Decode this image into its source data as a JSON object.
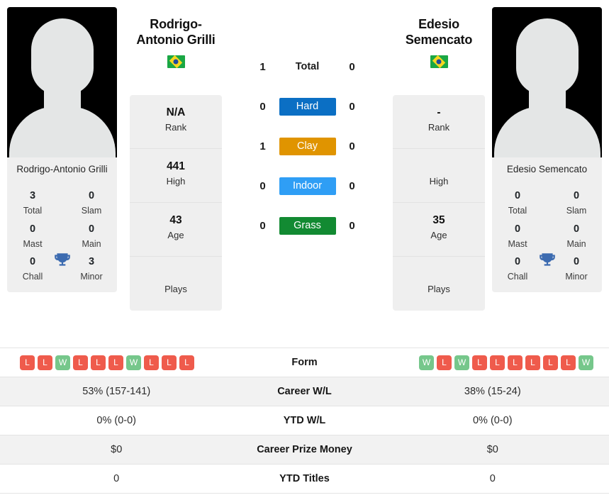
{
  "players": {
    "left": {
      "name": "Rodrigo-Antonio Grilli",
      "caption": "Rodrigo-Antonio Grilli",
      "country_flag": "brazil-flag",
      "info": [
        {
          "value": "N/A",
          "label": "Rank"
        },
        {
          "value": "441",
          "label": "High"
        },
        {
          "value": "43",
          "label": "Age"
        },
        {
          "value": "",
          "label": "Plays"
        }
      ],
      "titles": [
        {
          "value": "3",
          "label": "Total"
        },
        {
          "value": "0",
          "label": "Slam"
        },
        {
          "value": "0",
          "label": "Mast"
        },
        {
          "value": "0",
          "label": "Main"
        },
        {
          "value": "0",
          "label": "Chall"
        },
        {
          "value": "3",
          "label": "Minor"
        }
      ],
      "form": [
        "L",
        "L",
        "W",
        "L",
        "L",
        "L",
        "W",
        "L",
        "L",
        "L"
      ]
    },
    "right": {
      "name": "Edesio Semencato",
      "caption": "Edesio Semencato",
      "country_flag": "brazil-flag",
      "info": [
        {
          "value": "-",
          "label": "Rank"
        },
        {
          "value": "",
          "label": "High"
        },
        {
          "value": "35",
          "label": "Age"
        },
        {
          "value": "",
          "label": "Plays"
        }
      ],
      "titles": [
        {
          "value": "0",
          "label": "Total"
        },
        {
          "value": "0",
          "label": "Slam"
        },
        {
          "value": "0",
          "label": "Mast"
        },
        {
          "value": "0",
          "label": "Main"
        },
        {
          "value": "0",
          "label": "Chall"
        },
        {
          "value": "0",
          "label": "Minor"
        }
      ],
      "form": [
        "W",
        "L",
        "W",
        "L",
        "L",
        "L",
        "L",
        "L",
        "L",
        "W"
      ]
    }
  },
  "h2h": {
    "rows": [
      {
        "left": "1",
        "label": "Total",
        "right": "0",
        "type": "total",
        "color": ""
      },
      {
        "left": "0",
        "label": "Hard",
        "right": "0",
        "type": "surface",
        "color": "#0b6fc4"
      },
      {
        "left": "1",
        "label": "Clay",
        "right": "0",
        "type": "surface",
        "color": "#e09400"
      },
      {
        "left": "0",
        "label": "Indoor",
        "right": "0",
        "type": "surface",
        "color": "#2f9ef5"
      },
      {
        "left": "0",
        "label": "Grass",
        "right": "0",
        "type": "surface",
        "color": "#128a32"
      }
    ]
  },
  "comparison": {
    "rows": [
      {
        "label": "Form",
        "left": "",
        "right": "",
        "type": "form"
      },
      {
        "label": "Career W/L",
        "left": "53% (157-141)",
        "right": "38% (15-24)",
        "type": "text"
      },
      {
        "label": "YTD W/L",
        "left": "0% (0-0)",
        "right": "0% (0-0)",
        "type": "text"
      },
      {
        "label": "Career Prize Money",
        "left": "$0",
        "right": "$0",
        "type": "text"
      },
      {
        "label": "YTD Titles",
        "left": "0",
        "right": "0",
        "type": "text"
      }
    ]
  },
  "colors": {
    "win": "#76c78b",
    "loss": "#ef5b4c",
    "trophy": "#3c6bb0",
    "card_bg": "#efefef",
    "stripe": "#f2f2f2"
  }
}
